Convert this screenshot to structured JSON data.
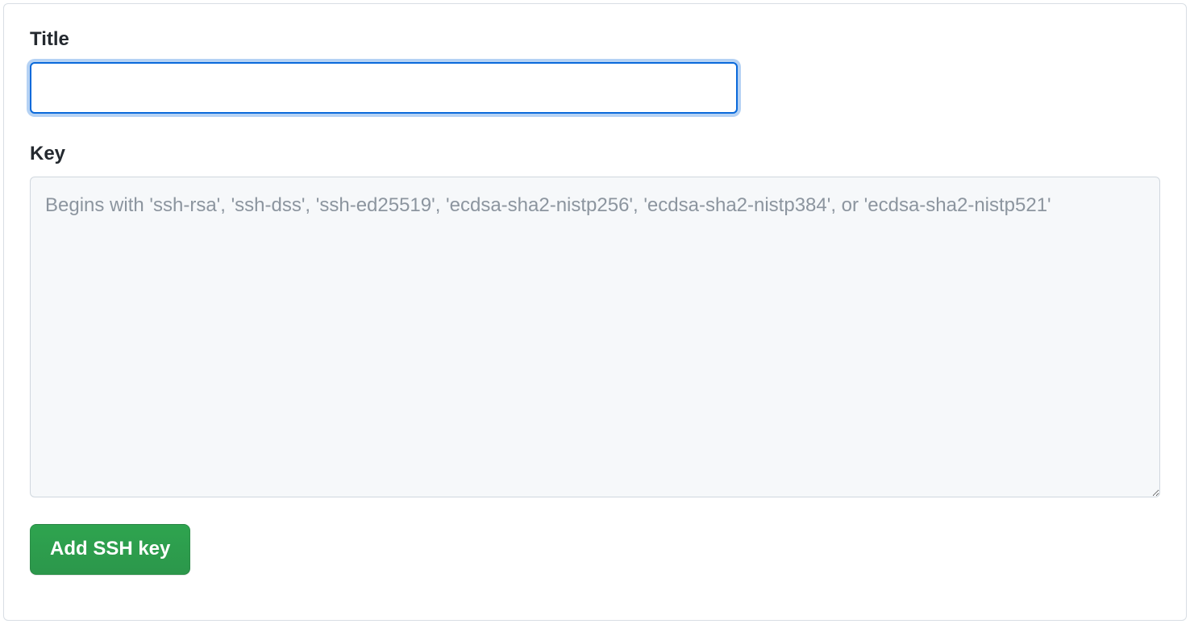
{
  "form": {
    "title": {
      "label": "Title",
      "value": ""
    },
    "key": {
      "label": "Key",
      "placeholder": "Begins with 'ssh-rsa', 'ssh-dss', 'ssh-ed25519', 'ecdsa-sha2-nistp256', 'ecdsa-sha2-nistp384', or 'ecdsa-sha2-nistp521'",
      "value": ""
    },
    "submit_label": "Add SSH key"
  }
}
